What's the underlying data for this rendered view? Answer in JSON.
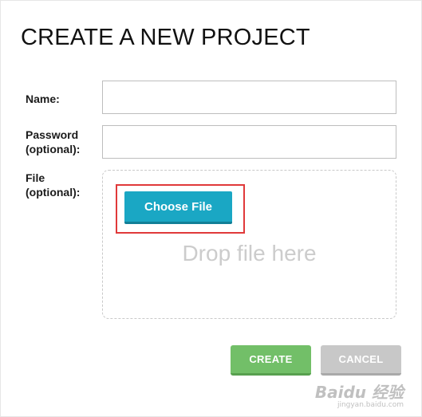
{
  "dialog": {
    "title": "CREATE A NEW PROJECT"
  },
  "form": {
    "name_label": "Name:",
    "name_value": "",
    "password_label_line1": "Password",
    "password_label_line2": "(optional):",
    "password_value": "",
    "file_label_line1": "File",
    "file_label_line2": "(optional):",
    "choose_file_label": "Choose File",
    "drop_text": "Drop file here"
  },
  "actions": {
    "create_label": "CREATE",
    "cancel_label": "CANCEL"
  },
  "watermark": {
    "logo": "Baidu 经验",
    "sub": "jingyan.baidu.com"
  },
  "colors": {
    "choose_button": "#1aa7c4",
    "create_button": "#72bf68",
    "cancel_button": "#c8c8c8",
    "highlight": "#e0393a"
  }
}
